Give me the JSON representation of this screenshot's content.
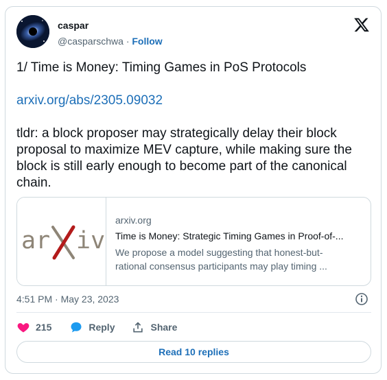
{
  "author": {
    "name": "caspar",
    "handle": "@casparschwa",
    "separator": "·",
    "follow_label": "Follow",
    "avatar_icon": "galaxy-avatar"
  },
  "tweet": {
    "line1": "1/ Time is Money: Timing Games in PoS Protocols",
    "link": "arxiv.org/abs/2305.09032",
    "body": "tldr: a block proposer may strategically delay their block proposal to maximize MEV capture, while making sure the block is still early enough to become part of the canonical chain."
  },
  "preview": {
    "logo_text": "arXiv",
    "domain": "arxiv.org",
    "title": "Time is Money: Strategic Timing Games in Proof-of-...",
    "desc_line1": "We propose a model suggesting that honest-but-",
    "desc_line2": "rational consensus participants may play timing ..."
  },
  "meta": {
    "timestamp": "4:51 PM · May 23, 2023"
  },
  "actions": {
    "like_count": "215",
    "reply_label": "Reply",
    "share_label": "Share"
  },
  "read_replies_label": "Read 10 replies",
  "colors": {
    "link": "#1d6fb8",
    "like": "#f91880",
    "reply": "#1d9bf0",
    "muted": "#536471",
    "arxiv_gray": "#8e8577",
    "arxiv_red": "#b31b1b"
  }
}
